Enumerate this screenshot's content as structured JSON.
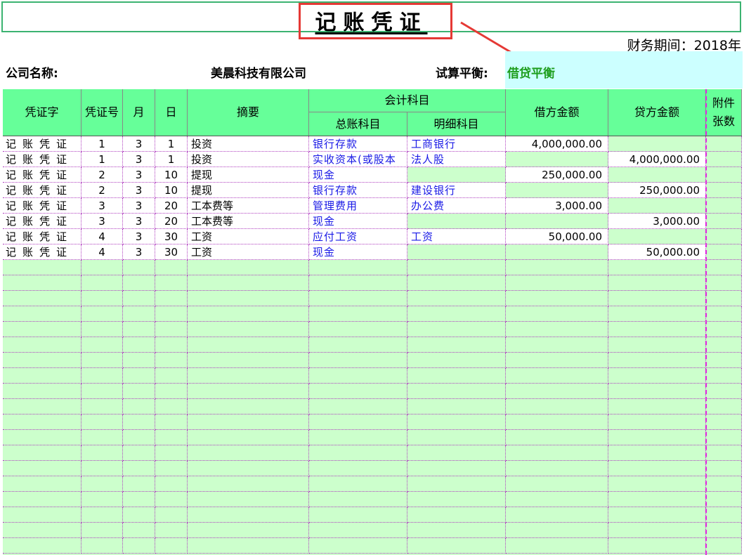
{
  "title": "记账凭证",
  "period": {
    "label": "财务期间：",
    "value": "2018年"
  },
  "company": {
    "label": "公司名称:",
    "name": "美晨科技有限公司"
  },
  "trial_balance": {
    "label": "试算平衡:",
    "value": "借贷平衡"
  },
  "colors": {
    "header_bg": "#66ff99",
    "body_bg": "#ccffcc",
    "highlight": "#ccffff",
    "title_box": "#e53935",
    "link_text": "#1a1ae6",
    "balance_text": "#1e9e1e"
  },
  "headers": {
    "voucher_type": "凭证字",
    "voucher_no": "凭证号",
    "month": "月",
    "day": "日",
    "summary": "摘要",
    "account_group": "会计科目",
    "general_account": "总账科目",
    "detail_account": "明细科目",
    "debit": "借方金额",
    "credit": "贷方金额",
    "attachments_1": "附件",
    "attachments_2": "张数"
  },
  "rows": [
    {
      "type": "记账凭证",
      "no": "1",
      "month": "3",
      "day": "1",
      "summary": "投资",
      "general": "银行存款",
      "detail": "工商银行",
      "debit": "4,000,000.00",
      "credit": ""
    },
    {
      "type": "记账凭证",
      "no": "1",
      "month": "3",
      "day": "1",
      "summary": "投资",
      "general": "实收资本(或股本",
      "detail": "法人股",
      "debit": "",
      "credit": "4,000,000.00"
    },
    {
      "type": "记账凭证",
      "no": "2",
      "month": "3",
      "day": "10",
      "summary": "提现",
      "general": "现金",
      "detail": "",
      "debit": "250,000.00",
      "credit": ""
    },
    {
      "type": "记账凭证",
      "no": "2",
      "month": "3",
      "day": "10",
      "summary": "提现",
      "general": "银行存款",
      "detail": "建设银行",
      "debit": "",
      "credit": "250,000.00"
    },
    {
      "type": "记账凭证",
      "no": "3",
      "month": "3",
      "day": "20",
      "summary": "工本费等",
      "general": "管理费用",
      "detail": "办公费",
      "debit": "3,000.00",
      "credit": ""
    },
    {
      "type": "记账凭证",
      "no": "3",
      "month": "3",
      "day": "20",
      "summary": "工本费等",
      "general": "现金",
      "detail": "",
      "debit": "",
      "credit": "3,000.00"
    },
    {
      "type": "记账凭证",
      "no": "4",
      "month": "3",
      "day": "30",
      "summary": "工资",
      "general": "应付工资",
      "detail": "工资",
      "debit": "50,000.00",
      "credit": ""
    },
    {
      "type": "记账凭证",
      "no": "4",
      "month": "3",
      "day": "30",
      "summary": "工资",
      "general": "现金",
      "detail": "",
      "debit": "",
      "credit": "50,000.00"
    }
  ]
}
